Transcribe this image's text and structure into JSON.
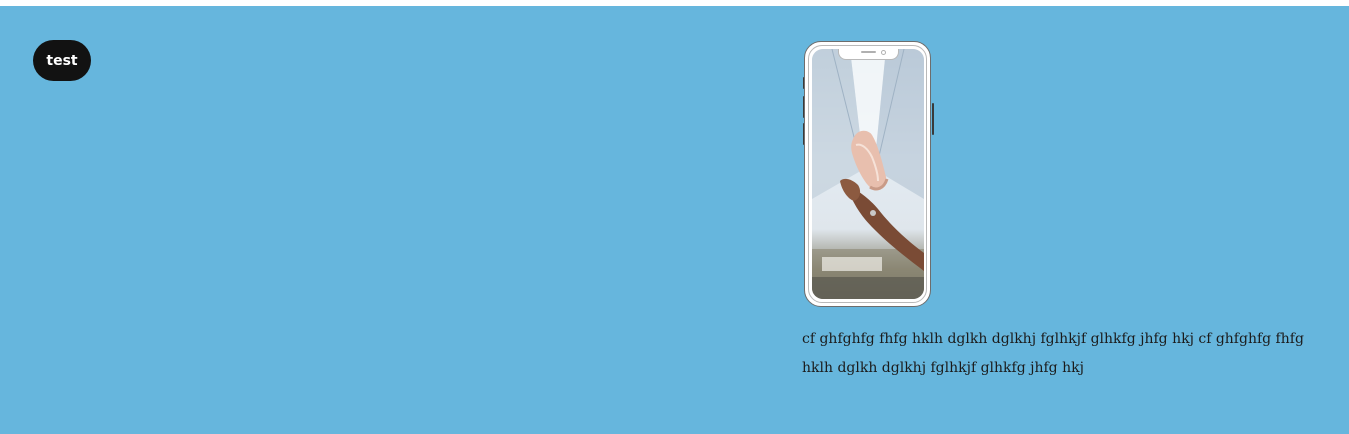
{
  "button": {
    "label": "test"
  },
  "phone": {
    "screen_image": "sneaker-held-in-hand-photo"
  },
  "caption": {
    "text": "cf ghfghfg fhfg hklh dglkh dglkhj fglhkjf glhkfg jhfg hkj cf ghfghfg fhfg hklh dglkh dglkhj fglhkjf glhkfg jhfg hkj"
  },
  "colors": {
    "background": "#66b6dd",
    "button": "#121212",
    "button_text": "#ffffff"
  }
}
